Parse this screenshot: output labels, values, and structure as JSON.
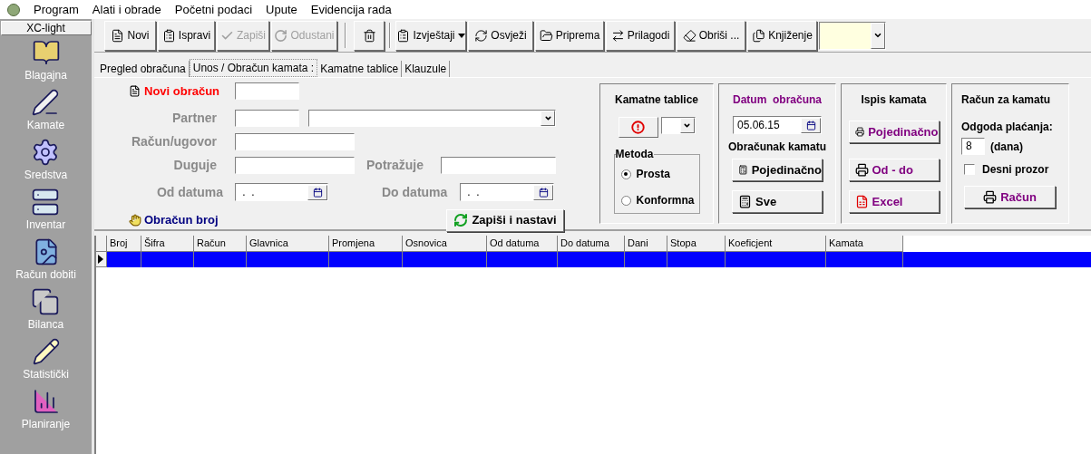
{
  "menu": [
    {
      "label": "Program"
    },
    {
      "label": "Alati i obrade"
    },
    {
      "label": "Početni podaci"
    },
    {
      "label": "Upute"
    },
    {
      "label": "Evidencija rada"
    }
  ],
  "sidebar": {
    "title": "XC-light",
    "items": [
      {
        "label": "Blagajna"
      },
      {
        "label": "Kamate"
      },
      {
        "label": "Sredstva"
      },
      {
        "label": "Inventar"
      },
      {
        "label": "Račun dobiti"
      },
      {
        "label": "Bilanca"
      },
      {
        "label": "Statistički"
      },
      {
        "label": "Planiranje"
      }
    ]
  },
  "toolbar": [
    {
      "kind": "button",
      "label": "Novi",
      "disabled": false
    },
    {
      "kind": "button",
      "label": "Ispravi",
      "disabled": false
    },
    {
      "kind": "button",
      "label": "Zapiši",
      "disabled": true
    },
    {
      "kind": "button",
      "label": "Odustani",
      "disabled": true
    },
    {
      "kind": "icon",
      "disabled": false
    },
    {
      "kind": "dropdown",
      "label": "Izvještaji",
      "disabled": false
    },
    {
      "kind": "button",
      "label": "Osvježi",
      "disabled": false
    },
    {
      "kind": "button",
      "label": "Priprema",
      "disabled": false
    },
    {
      "kind": "button",
      "label": "Prilagodi",
      "disabled": false
    },
    {
      "kind": "button",
      "label": "Obriši ...",
      "disabled": false
    },
    {
      "kind": "button",
      "label": "Knjiženje",
      "disabled": false
    }
  ],
  "tabs": [
    {
      "label": "Pregled obračuna",
      "selected": false
    },
    {
      "label": "Unos / Obračun kamata :",
      "selected": true
    },
    {
      "label": "Kamatne tablice",
      "selected": false
    },
    {
      "label": "Klauzule",
      "selected": false
    }
  ],
  "form": {
    "new_label": "Novi obračun",
    "partner": "Partner",
    "account": "Račun/ugovor",
    "debit": "Duguje",
    "credit": "Potražuje",
    "date_from": "Od datuma",
    "date_from_value": " .  .",
    "date_to": "Do datuma",
    "date_to_value": " .  .",
    "calc_number": "Obračun broj",
    "save_button": "Zapiši i nastavi"
  },
  "panels": {
    "tables": {
      "title": "Kamatne tablice",
      "method_title": "Metoda",
      "methods": [
        {
          "label": "Prosta",
          "selected": true
        },
        {
          "label": "Konformna",
          "selected": false
        }
      ]
    },
    "date": {
      "title": "Datum  obračuna",
      "value": "05.06.15",
      "calc_title": "Obračunak kamatu",
      "buttons": [
        "Pojedinačno",
        "Sve"
      ]
    },
    "print": {
      "title": "Ispis kamata",
      "buttons": [
        {
          "label": "Pojedinačno",
          "kind": "print"
        },
        {
          "label": "Od - do",
          "kind": "print"
        },
        {
          "label": "Excel",
          "kind": "excel"
        }
      ]
    },
    "invoice": {
      "title": "Račun za kamatu",
      "delay_label": "Odgoda plaćanja:",
      "delay_value": "8",
      "delay_unit": "(dana)",
      "right_window": {
        "label": "Desni prozor",
        "checked": false
      },
      "button": "Račun"
    }
  },
  "table": {
    "columns": [
      "Broj",
      "Šifra",
      "Račun",
      "Glavnica",
      "Promjena",
      "Osnovica",
      "Od datuma",
      "Do datuma",
      "Dani",
      "Stopa",
      "Koeficjent",
      "Kamata"
    ],
    "rows": [
      {
        "selected": true
      }
    ]
  }
}
